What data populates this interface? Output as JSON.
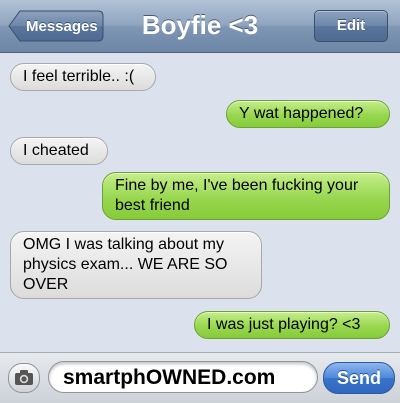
{
  "header": {
    "back_label": "Messages",
    "title": "Boyfie <3",
    "edit_label": "Edit"
  },
  "messages": [
    {
      "side": "received",
      "text": "I feel terrible.. :("
    },
    {
      "side": "sent",
      "text": "Y wat happened?"
    },
    {
      "side": "received",
      "text": "I cheated"
    },
    {
      "side": "sent",
      "text": "Fine by me, I've been fucking your best friend"
    },
    {
      "side": "received",
      "text": "OMG I was talking about my physics exam... WE ARE SO OVER"
    },
    {
      "side": "sent",
      "text": "I was just playing? <3"
    }
  ],
  "composer": {
    "input_text": "smartphOWNED.com",
    "send_label": "Send",
    "camera_icon": "camera-icon"
  },
  "colors": {
    "nav_bar": "#7f96b4",
    "sent_bubble": "#98d74f",
    "received_bubble": "#e4e4e4",
    "send_button": "#3a74c9",
    "background": "#dbe2ed"
  }
}
